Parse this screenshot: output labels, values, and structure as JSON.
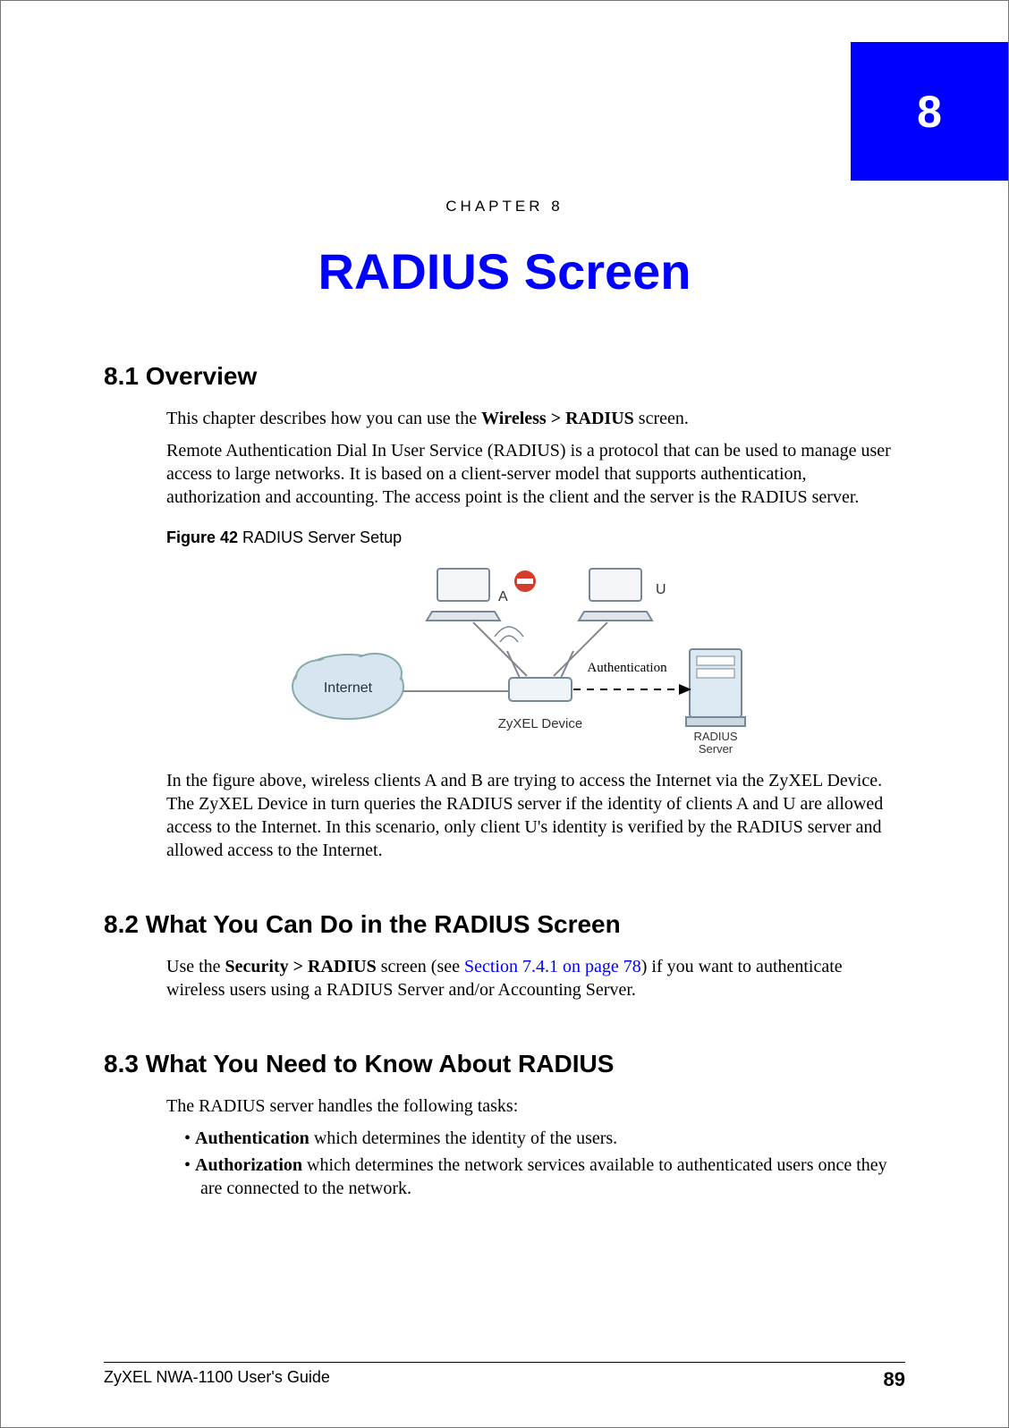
{
  "chapter": {
    "number": "8",
    "label": "CHAPTER   8",
    "title": "RADIUS Screen"
  },
  "sections": {
    "s81": {
      "heading": "8.1  Overview",
      "p1_a": "This chapter describes how you can use the ",
      "p1_b": "Wireless > RADIUS",
      "p1_c": " screen.",
      "p2": "Remote Authentication Dial In User Service (RADIUS) is a protocol that can be used to manage user access to large networks. It is based on a client-server model that supports authentication, authorization and accounting. The access point is the client and the server is the RADIUS server.",
      "fig_num": "Figure 42",
      "fig_title": "   RADIUS Server Setup",
      "fig_labels": {
        "A": "A",
        "U": "U",
        "internet": "Internet",
        "zyxel": "ZyXEL Device",
        "radius1": "RADIUS",
        "radius2": "Server",
        "auth": "Authentication"
      },
      "p3": "In the figure above, wireless clients A and B are trying to access the Internet via the ZyXEL Device. The ZyXEL Device in turn queries the RADIUS server if the identity of clients A and U are allowed access to the Internet. In this scenario, only client U's identity is verified by the RADIUS server and allowed access to the Internet."
    },
    "s82": {
      "heading": "8.2  What You Can Do in the RADIUS Screen",
      "p1_a": "Use the ",
      "p1_b": "Security > RADIUS",
      "p1_c": " screen (see ",
      "p1_link": "Section 7.4.1 on page 78",
      "p1_d": ") if you want to authenticate wireless users using a RADIUS Server and/or Accounting Server."
    },
    "s83": {
      "heading": "8.3  What You Need to Know About RADIUS",
      "p1": "The RADIUS server handles the following tasks:",
      "bullet1_b": "Authentication",
      "bullet1_t": " which determines the identity of the users.",
      "bullet2_b": "Authorization",
      "bullet2_t": " which determines the network services available to authenticated users once they are connected to the network."
    }
  },
  "footer": {
    "doc": "ZyXEL NWA-1100 User's Guide",
    "page": "89"
  }
}
